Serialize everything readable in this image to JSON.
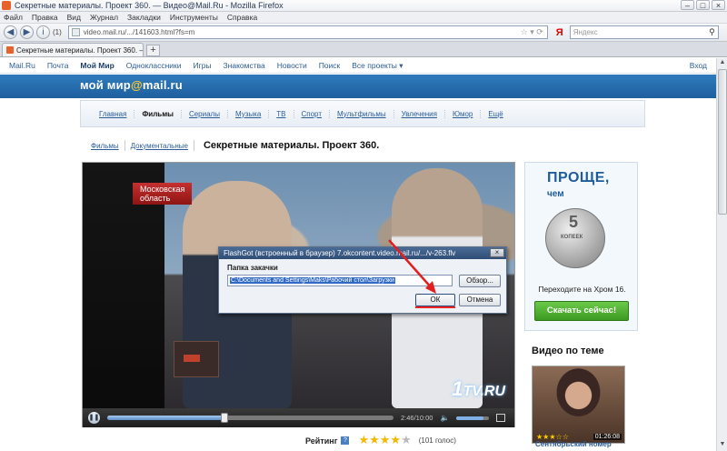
{
  "browser": {
    "window_title": "Секретные материалы. Проект 360. — Видео@Mail.Ru - Mozilla Firefox",
    "window_buttons": [
      "–",
      "□",
      "×"
    ],
    "menu": [
      "Файл",
      "Правка",
      "Вид",
      "Журнал",
      "Закладки",
      "Инструменты",
      "Справка"
    ],
    "history_count": "(1)",
    "url": "video.mail.ru/.../141603.html?fs=m",
    "search_engine_icon": "yandex-icon",
    "search_placeholder": "Яндекс",
    "tabs": [
      {
        "label": "Секретные материалы. Проект 360. — Ви...",
        "close": "×"
      }
    ],
    "new_tab": "+"
  },
  "portal": {
    "links": [
      "Mail.Ru",
      "Почта",
      "Мой Мир",
      "Одноклассники",
      "Игры",
      "Знакомства",
      "Новости",
      "Поиск",
      "Все проекты ▾"
    ],
    "active_link": "Мой Мир",
    "login": "Вход"
  },
  "site": {
    "logo_text": "мой мир",
    "logo_at": "@",
    "logo_domain": "mail.ru"
  },
  "categories": {
    "items": [
      "Главная",
      "Фильмы",
      "Сериалы",
      "Музыка",
      "ТВ",
      "Спорт",
      "Мультфильмы",
      "Увлечения",
      "Юмор",
      "Ещё"
    ],
    "active": "Фильмы"
  },
  "breadcrumbs": {
    "items": [
      "Фильмы",
      "Документальные"
    ],
    "heading": "Секретные материалы. Проект 360."
  },
  "player": {
    "location_tag_line1": "Московская",
    "location_tag_line2": "область",
    "channel_watermark_num": "1",
    "channel_watermark_text": "TV.RU",
    "time": "2:46/10:00",
    "progress": 0.41,
    "volume": 0.83
  },
  "rating": {
    "label": "Рейтинг",
    "help": "?",
    "value": 4,
    "max": 5,
    "votes": "(101 голос)",
    "colors": {
      "on": "#f5b800",
      "off": "#bbbbbb"
    }
  },
  "ad": {
    "headline": "ПРОЩЕ,",
    "subline": "чем",
    "coin_digit": "5",
    "coin_word": "КОПЕЕК",
    "text": "Переходите на Хром 16.",
    "button": "Скачать сейчас!"
  },
  "related": {
    "title": "Видео по теме",
    "thumb_stars": "★★★☆☆",
    "duration": "01:26:08",
    "caption": "Сентябрьский номер"
  },
  "dialog": {
    "title": "FlashGot (встроенный в браузер) 7.okcontent.video.mail.ru/.../v-263.flv",
    "close": "×",
    "label": "Папка закачки",
    "path": "C:\\Documents and Settings\\Maks\\Рабочий стол\\Загрузки",
    "browse_button": "Обзор...",
    "ok_button": "ОК",
    "cancel_button": "Отмена"
  },
  "colors": {
    "mirbar": "#2569a9",
    "link": "#2c5d97",
    "ad_button": "#4aab2c",
    "annotation": "#e02020"
  }
}
